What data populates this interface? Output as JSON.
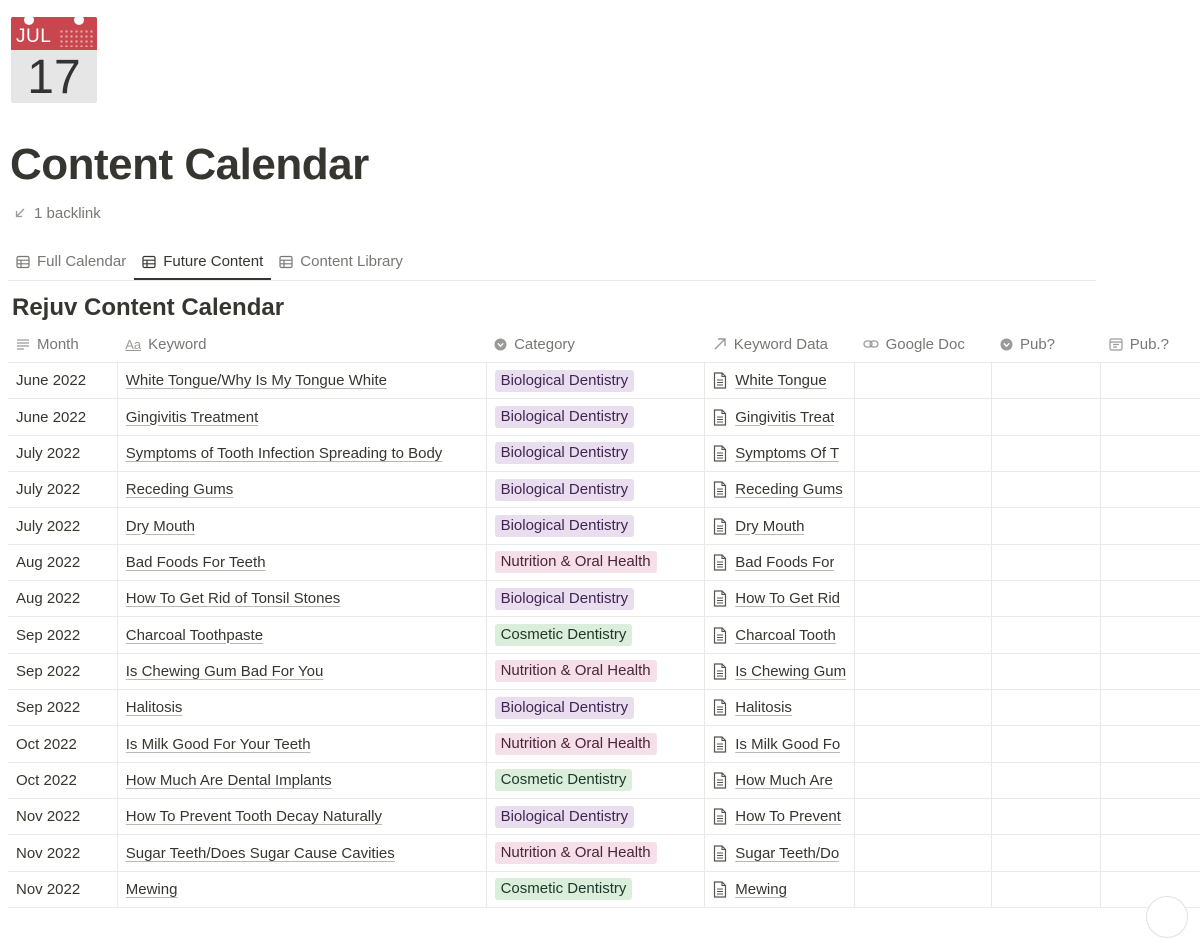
{
  "page": {
    "icon": {
      "name": "calendar-icon",
      "month": "JUL",
      "day": "17"
    },
    "title": "Content Calendar",
    "backlink": "1 backlink"
  },
  "tabs": [
    {
      "label": "Full Calendar",
      "active": false
    },
    {
      "label": "Future Content",
      "active": true
    },
    {
      "label": "Content Library",
      "active": false
    }
  ],
  "database": {
    "title": "Rejuv Content Calendar",
    "columns": [
      {
        "label": "Month",
        "icon": "text-lines-icon"
      },
      {
        "label": "Keyword",
        "icon": "title-aa-icon"
      },
      {
        "label": "Category",
        "icon": "select-icon"
      },
      {
        "label": "Keyword Data",
        "icon": "relation-arrow-icon"
      },
      {
        "label": "Google Doc",
        "icon": "link-icon"
      },
      {
        "label": "Pub?",
        "icon": "select-icon"
      },
      {
        "label": "Pub.?",
        "icon": "date-icon"
      }
    ],
    "category_colors": {
      "Biological Dentistry": {
        "bg": "#e8deee",
        "fg": "#412454"
      },
      "Nutrition & Oral Health": {
        "bg": "#f5e0e9",
        "fg": "#4c2337"
      },
      "Cosmetic Dentistry": {
        "bg": "#dbeddb",
        "fg": "#1c3829"
      }
    },
    "rows": [
      {
        "month": "June 2022",
        "keyword": "White Tongue/Why Is My Tongue White",
        "category": "Biological Dentistry",
        "keyword_data": "White Tongue"
      },
      {
        "month": "June 2022",
        "keyword": "Gingivitis Treatment",
        "category": "Biological Dentistry",
        "keyword_data": "Gingivitis Treat"
      },
      {
        "month": "July 2022",
        "keyword": "Symptoms of Tooth Infection Spreading to Body",
        "category": "Biological Dentistry",
        "keyword_data": "Symptoms Of T"
      },
      {
        "month": "July 2022",
        "keyword": "Receding Gums",
        "category": "Biological Dentistry",
        "keyword_data": "Receding Gums"
      },
      {
        "month": "July 2022",
        "keyword": "Dry Mouth",
        "category": "Biological Dentistry",
        "keyword_data": "Dry Mouth"
      },
      {
        "month": "Aug 2022",
        "keyword": "Bad Foods For Teeth",
        "category": "Nutrition & Oral Health",
        "keyword_data": "Bad Foods For"
      },
      {
        "month": "Aug 2022",
        "keyword": "How To Get Rid of Tonsil Stones",
        "category": "Biological Dentistry",
        "keyword_data": "How To Get Rid"
      },
      {
        "month": "Sep 2022",
        "keyword": "Charcoal Toothpaste",
        "category": "Cosmetic Dentistry",
        "keyword_data": "Charcoal Tooth"
      },
      {
        "month": "Sep 2022",
        "keyword": "Is Chewing Gum Bad For You",
        "category": "Nutrition & Oral Health",
        "keyword_data": "Is Chewing Gum"
      },
      {
        "month": "Sep 2022",
        "keyword": "Halitosis",
        "category": "Biological Dentistry",
        "keyword_data": "Halitosis"
      },
      {
        "month": "Oct 2022",
        "keyword": "Is Milk Good For Your Teeth",
        "category": "Nutrition & Oral Health",
        "keyword_data": "Is Milk Good Fo"
      },
      {
        "month": "Oct 2022",
        "keyword": "How Much Are Dental Implants",
        "category": "Cosmetic Dentistry",
        "keyword_data": "How Much Are"
      },
      {
        "month": "Nov 2022",
        "keyword": "How To Prevent Tooth Decay Naturally",
        "category": "Biological Dentistry",
        "keyword_data": "How To Prevent"
      },
      {
        "month": "Nov 2022",
        "keyword": "Sugar Teeth/Does Sugar Cause Cavities",
        "category": "Nutrition & Oral Health",
        "keyword_data": "Sugar Teeth/Do"
      },
      {
        "month": "Nov 2022",
        "keyword": "Mewing",
        "category": "Cosmetic Dentistry",
        "keyword_data": "Mewing"
      }
    ]
  }
}
